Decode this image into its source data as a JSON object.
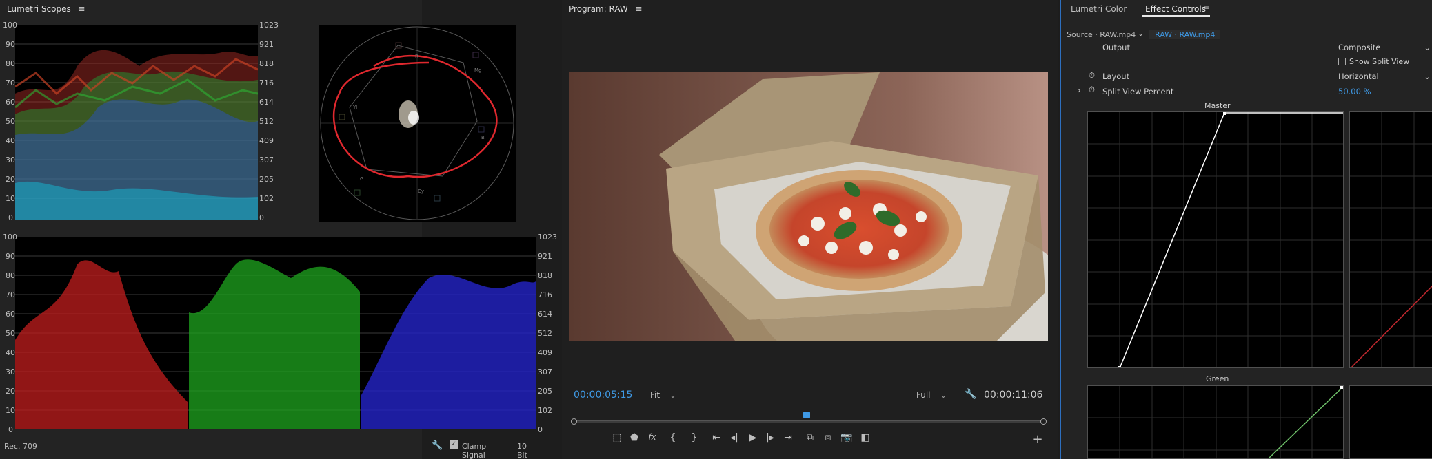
{
  "scopes": {
    "title": "Lumetri Scopes",
    "left_ticks": [
      "100",
      "90",
      "80",
      "70",
      "60",
      "50",
      "40",
      "30",
      "20",
      "10",
      "0"
    ],
    "right_ticks": [
      "1023",
      "921",
      "818",
      "716",
      "614",
      "512",
      "409",
      "307",
      "205",
      "102",
      "0"
    ],
    "vectorscope_labels": {
      "r": "R",
      "mg": "Mg",
      "b": "B",
      "cy": "Cy",
      "g": "G",
      "yl": "Yl"
    },
    "footer": {
      "colorspace": "Rec. 709",
      "clamp_label": "Clamp Signal",
      "bit_depth": "10 Bit"
    }
  },
  "program": {
    "title": "Program: RAW",
    "timecode_current": "00:00:05:15",
    "fit": "Fit",
    "quality": "Full",
    "timecode_duration": "00:00:11:06",
    "playhead_fraction": 0.5
  },
  "tabs": {
    "lumetri_color": "Lumetri Color",
    "effect_controls": "Effect Controls"
  },
  "effect_controls": {
    "source": "Source · RAW.mp4",
    "clip": "RAW · RAW.mp4",
    "output_label": "Output",
    "output_value": "Composite",
    "split_view_label": "Show Split View",
    "layout_label": "Layout",
    "layout_value": "Horizontal",
    "split_percent_label": "Split View Percent",
    "split_percent_value": "50.00 %",
    "master_label": "Master",
    "green_label": "Green"
  },
  "colors": {
    "accent": "#3f9ae6",
    "curve_red": "#c0282e",
    "curve_green": "#6fc16a",
    "annotation": "#e0282e"
  }
}
